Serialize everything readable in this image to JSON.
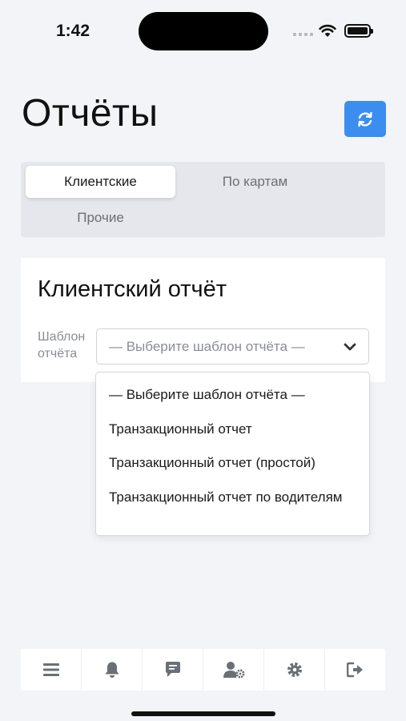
{
  "status_bar": {
    "time": "1:42"
  },
  "header": {
    "title": "Отчёты",
    "refresh_icon": "refresh-icon",
    "accent": "#3b8df0"
  },
  "tabs": [
    {
      "label": "Клиентские",
      "active": true
    },
    {
      "label": "По картам",
      "active": false
    },
    {
      "label": "Прочие",
      "active": false
    }
  ],
  "report": {
    "title": "Клиентский отчёт",
    "template_label": "Шаблон отчёта",
    "template_placeholder": "— Выберите шаблон отчёта —"
  },
  "dropdown": {
    "options": [
      "— Выберите шаблон отчёта —",
      "Транзакционный отчет",
      "Транзакционный отчет (простой)",
      "Транзакционный отчет по водителям"
    ]
  },
  "bottom_nav": [
    {
      "icon": "menu-icon"
    },
    {
      "icon": "bell-icon"
    },
    {
      "icon": "chat-icon"
    },
    {
      "icon": "user-settings-icon"
    },
    {
      "icon": "gear-icon"
    },
    {
      "icon": "logout-icon"
    }
  ]
}
